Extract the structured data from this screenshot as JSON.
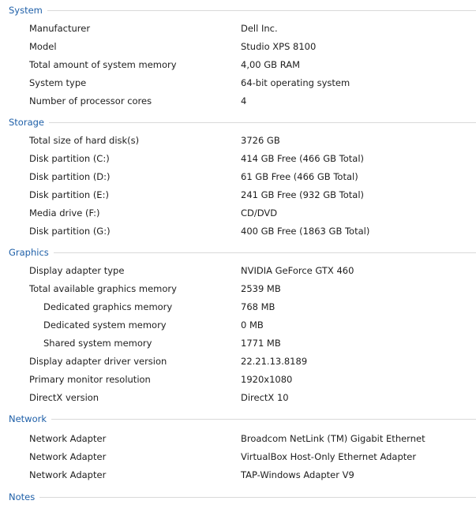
{
  "sections": [
    {
      "title": "System",
      "rows": [
        {
          "label": "Manufacturer",
          "value": "Dell Inc.",
          "indent": false
        },
        {
          "label": "Model",
          "value": "Studio XPS 8100",
          "indent": false
        },
        {
          "label": "Total amount of system memory",
          "value": "4,00 GB RAM",
          "indent": false
        },
        {
          "label": "System type",
          "value": "64-bit operating system",
          "indent": false
        },
        {
          "label": "Number of processor cores",
          "value": "4",
          "indent": false
        }
      ]
    },
    {
      "title": "Storage",
      "rows": [
        {
          "label": "Total size of hard disk(s)",
          "value": "3726 GB",
          "indent": false
        },
        {
          "label": "Disk partition (C:)",
          "value": "414 GB Free (466 GB Total)",
          "indent": false
        },
        {
          "label": "Disk partition (D:)",
          "value": "61 GB Free (466 GB Total)",
          "indent": false
        },
        {
          "label": "Disk partition (E:)",
          "value": "241 GB Free (932 GB Total)",
          "indent": false
        },
        {
          "label": "Media drive (F:)",
          "value": "CD/DVD",
          "indent": false
        },
        {
          "label": "Disk partition (G:)",
          "value": "400 GB Free (1863 GB Total)",
          "indent": false
        }
      ]
    },
    {
      "title": "Graphics",
      "rows": [
        {
          "label": "Display adapter type",
          "value": "NVIDIA GeForce GTX 460",
          "indent": false
        },
        {
          "label": "Total available graphics memory",
          "value": "2539 MB",
          "indent": false
        },
        {
          "label": "Dedicated graphics memory",
          "value": "768 MB",
          "indent": true
        },
        {
          "label": "Dedicated system memory",
          "value": "0 MB",
          "indent": true
        },
        {
          "label": "Shared system memory",
          "value": "1771 MB",
          "indent": true
        },
        {
          "label": "Display adapter driver version",
          "value": "22.21.13.8189",
          "indent": false
        },
        {
          "label": "Primary monitor resolution",
          "value": "1920x1080",
          "indent": false
        },
        {
          "label": "DirectX version",
          "value": "DirectX 10",
          "indent": false
        }
      ]
    },
    {
      "title": "Network",
      "rows": [
        {
          "label": "Network Adapter",
          "value": "Broadcom NetLink (TM) Gigabit Ethernet",
          "indent": false
        },
        {
          "label": "Network Adapter",
          "value": "VirtualBox Host-Only Ethernet Adapter",
          "indent": false
        },
        {
          "label": "Network Adapter",
          "value": "TAP-Windows Adapter V9",
          "indent": false
        }
      ]
    },
    {
      "title": "Notes",
      "rows": []
    }
  ]
}
